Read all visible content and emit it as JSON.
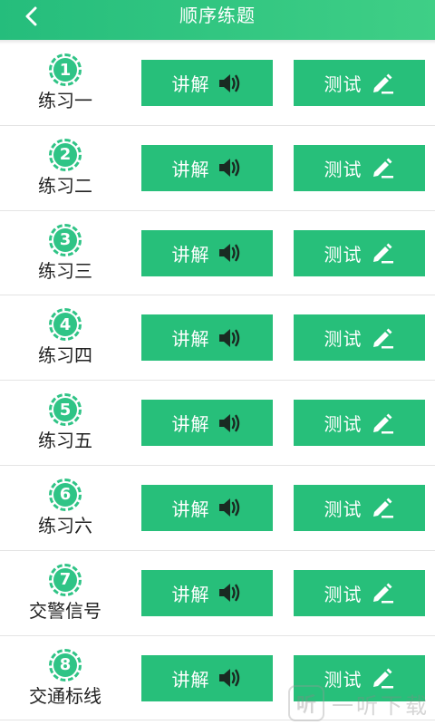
{
  "header": {
    "title": "顺序练题",
    "back_icon": "chevron-left-icon",
    "color_start": "#25bd7c",
    "color_end": "#3fcf86"
  },
  "buttons": {
    "explain_label": "讲解",
    "explain_icon": "speaker-icon",
    "test_label": "测试",
    "test_icon": "pencil-icon",
    "color": "#27bf7a"
  },
  "rows": [
    {
      "number": "1",
      "label": "练习一"
    },
    {
      "number": "2",
      "label": "练习二"
    },
    {
      "number": "3",
      "label": "练习三"
    },
    {
      "number": "4",
      "label": "练习四"
    },
    {
      "number": "5",
      "label": "练习五"
    },
    {
      "number": "6",
      "label": "练习六"
    },
    {
      "number": "7",
      "label": "交警信号"
    },
    {
      "number": "8",
      "label": "交通标线"
    }
  ],
  "watermark": {
    "text": "一听下载"
  }
}
